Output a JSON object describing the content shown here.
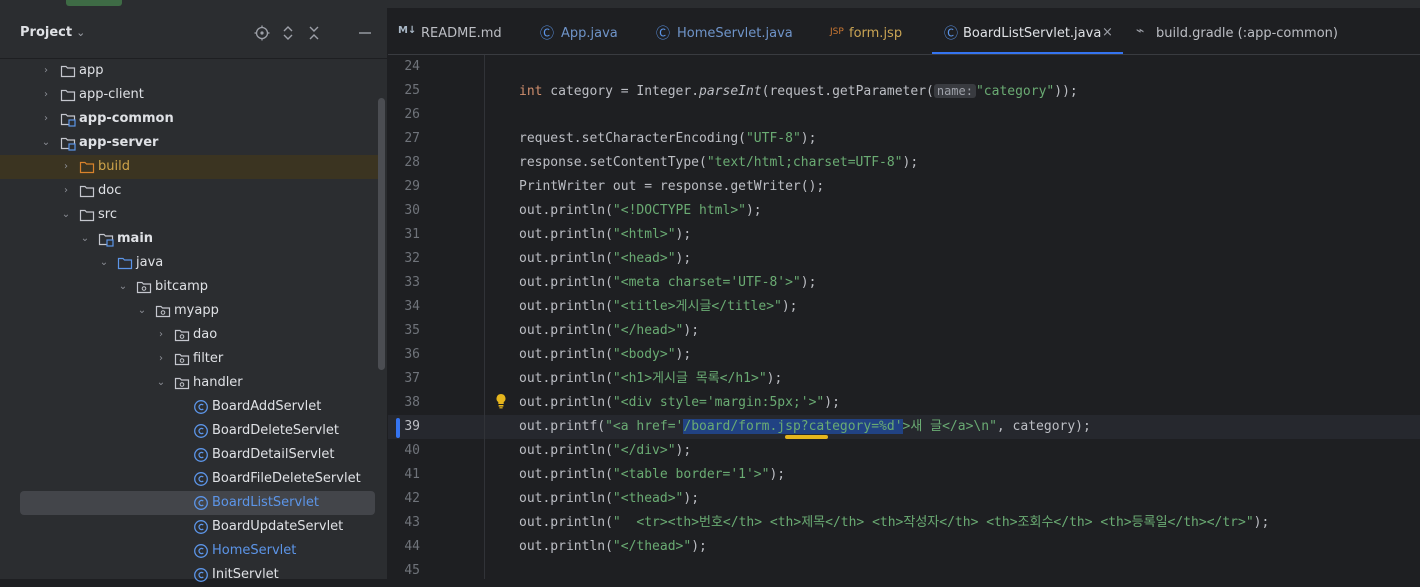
{
  "project_panel": {
    "title": "Project",
    "tree": [
      {
        "label": "app",
        "bold": false
      },
      {
        "label": "app-client",
        "bold": false
      },
      {
        "label": "app-common",
        "bold": true
      },
      {
        "label": "app-server",
        "bold": true
      },
      {
        "label": "build",
        "bold": false
      },
      {
        "label": "doc",
        "bold": false
      },
      {
        "label": "src",
        "bold": false
      },
      {
        "label": "main",
        "bold": true
      },
      {
        "label": "java",
        "bold": false
      },
      {
        "label": "bitcamp",
        "bold": false
      },
      {
        "label": "myapp",
        "bold": false
      },
      {
        "label": "dao",
        "bold": false
      },
      {
        "label": "filter",
        "bold": false
      },
      {
        "label": "handler",
        "bold": false
      },
      {
        "label": "BoardAddServlet",
        "bold": false
      },
      {
        "label": "BoardDeleteServlet",
        "bold": false
      },
      {
        "label": "BoardDetailServlet",
        "bold": false
      },
      {
        "label": "BoardFileDeleteServlet",
        "bold": false
      },
      {
        "label": "BoardListServlet",
        "bold": false
      },
      {
        "label": "BoardUpdateServlet",
        "bold": false
      },
      {
        "label": "HomeServlet",
        "bold": false
      },
      {
        "label": "InitServlet",
        "bold": false
      }
    ]
  },
  "tabs": [
    {
      "label": "README.md",
      "icon": "M↓",
      "icon_color": "#a9b7c6"
    },
    {
      "label": "App.java",
      "icon": "Ⓒ",
      "icon_color": "#5c95e8"
    },
    {
      "label": "HomeServlet.java",
      "icon": "Ⓒ",
      "icon_color": "#5c95e8"
    },
    {
      "label": "form.jsp",
      "icon": "JSP",
      "icon_color": "#cc7832"
    },
    {
      "label": "BoardListServlet.java",
      "icon": "Ⓒ",
      "icon_color": "#5c95e8"
    },
    {
      "label": "build.gradle (:app-common)",
      "icon": "⌁",
      "icon_color": "#9da0a8"
    }
  ],
  "editor": {
    "line_numbers": [
      "24",
      "25",
      "26",
      "27",
      "28",
      "29",
      "30",
      "31",
      "32",
      "33",
      "34",
      "35",
      "36",
      "37",
      "38",
      "39",
      "40",
      "41",
      "42",
      "43",
      "44",
      "45"
    ],
    "line25": {
      "kw": "int",
      "pre": " category = Integer.",
      "method": "parseInt",
      "mid": "(request.getParameter(",
      "hint": "name:",
      "str": "\"category\"",
      "post": "));"
    },
    "line27": {
      "pre": "request.setCharacterEncoding(",
      "str": "\"UTF-8\"",
      "post": ");"
    },
    "line28": {
      "pre": "response.setContentType(",
      "str": "\"text/html;charset=UTF-8\"",
      "post": ");"
    },
    "line29": {
      "pre": "PrintWriter out = response.getWriter();"
    },
    "line30": {
      "pre": "out.println(",
      "str": "\"<!DOCTYPE html>\"",
      "post": ");"
    },
    "line31": {
      "pre": "out.println(",
      "str": "\"<html>\"",
      "post": ");"
    },
    "line32": {
      "pre": "out.println(",
      "str": "\"<head>\"",
      "post": ");"
    },
    "line33": {
      "pre": "out.println(",
      "str": "\"<meta charset='UTF-8'>\"",
      "post": ");"
    },
    "line34": {
      "pre": "out.println(",
      "str": "\"<title>게시글</title>\"",
      "post": ");"
    },
    "line35": {
      "pre": "out.println(",
      "str": "\"</head>\"",
      "post": ");"
    },
    "line36": {
      "pre": "out.println(",
      "str": "\"<body>\"",
      "post": ");"
    },
    "line37": {
      "pre": "out.println(",
      "str": "\"<h1>게시글 목록</h1>\"",
      "post": ");"
    },
    "line38": {
      "pre": "out.println(",
      "str": "\"<div style='margin:5px;'>\"",
      "post": ");"
    },
    "line39": {
      "pre": "out.printf(",
      "str_a": "\"<a href='",
      "sel": "/board/form.jsp?category=%d'",
      "str_b": ">새 글</a>\\n\"",
      "post": ", category);"
    },
    "line40": {
      "pre": "out.println(",
      "str": "\"</div>\"",
      "post": ");"
    },
    "line41": {
      "pre": "out.println(",
      "str": "\"<table border='1'>\"",
      "post": ");"
    },
    "line42": {
      "pre": "out.println(",
      "str": "\"<thead>\"",
      "post": ");"
    },
    "line43": {
      "pre": "out.println(",
      "str": "\"  <tr><th>번호</th> <th>제목</th> <th>작성자</th> <th>조회수</th> <th>등록일</th></tr>\"",
      "post": ");"
    },
    "line44": {
      "pre": "out.println(",
      "str": "\"</thead>\"",
      "post": ");"
    }
  }
}
